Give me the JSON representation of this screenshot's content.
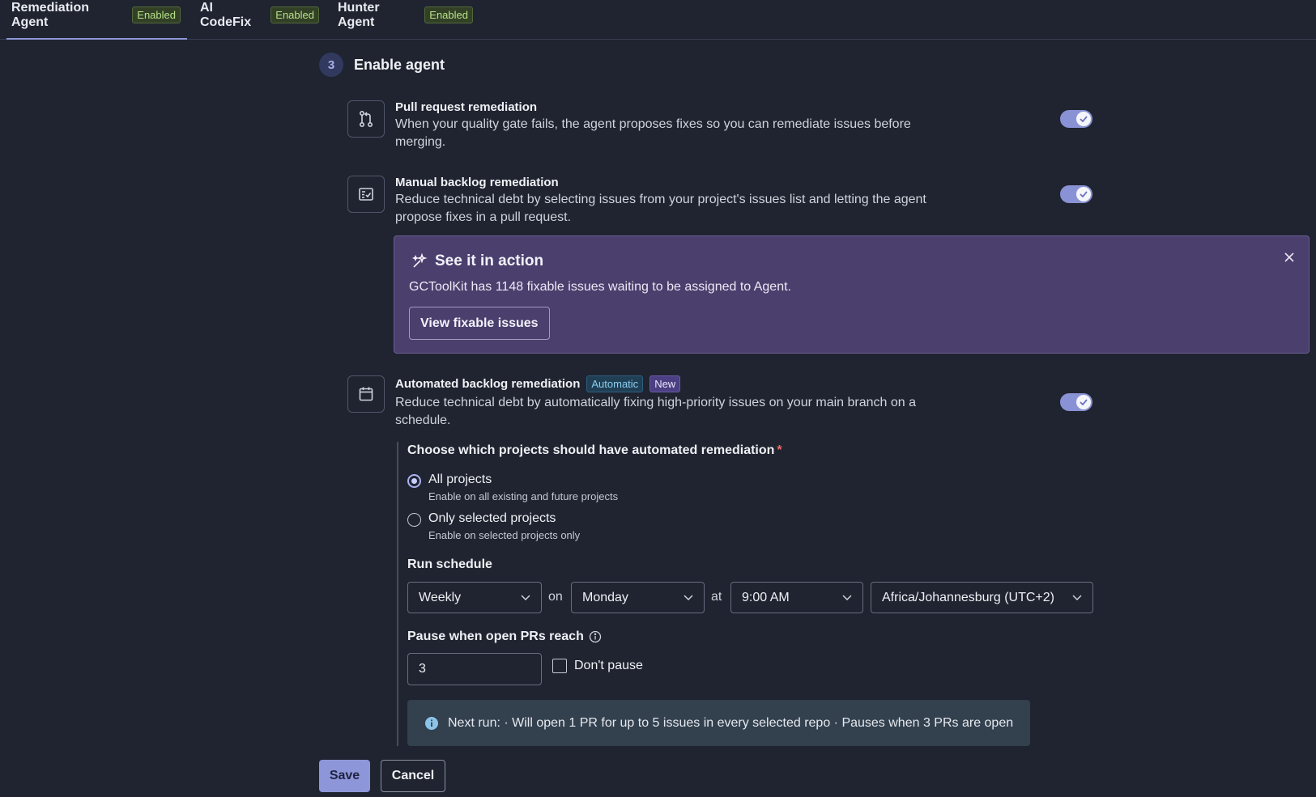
{
  "tabs": [
    {
      "label": "Remediation Agent",
      "badge": "Enabled",
      "active": true
    },
    {
      "label": "AI CodeFix",
      "badge": "Enabled",
      "active": false
    },
    {
      "label": "Hunter Agent",
      "badge": "Enabled",
      "active": false
    }
  ],
  "step": {
    "number": "3",
    "title": "Enable agent"
  },
  "features": {
    "pr": {
      "icon": "pull-request-icon",
      "title": "Pull request remediation",
      "description": "When your quality gate fails, the agent proposes fixes so you can remediate issues before merging.",
      "enabled": true
    },
    "manual": {
      "icon": "checklist-icon",
      "title": "Manual backlog remediation",
      "description": "Reduce technical debt by selecting issues from your project's issues list and letting the agent propose fixes in a pull request.",
      "enabled": true
    },
    "automated": {
      "icon": "calendar-icon",
      "title": "Automated backlog remediation",
      "chip_automatic": "Automatic",
      "chip_new": "New",
      "description": "Reduce technical debt by automatically fixing high-priority issues on your main branch on a schedule.",
      "enabled": true
    }
  },
  "promo": {
    "icon": "sparkle-icon",
    "title": "See it in action",
    "text": "GCToolKit has 1148 fixable issues waiting to be assigned to Agent.",
    "button": "View fixable issues"
  },
  "projects": {
    "label": "Choose which projects should have automated remediation",
    "required_mark": "*",
    "options": [
      {
        "label": "All projects",
        "sub": "Enable on all existing and future projects",
        "checked": true
      },
      {
        "label": "Only selected projects",
        "sub": "Enable on selected projects only",
        "checked": false
      }
    ]
  },
  "schedule": {
    "label": "Run schedule",
    "frequency": "Weekly",
    "on_text": "on",
    "day": "Monday",
    "at_text": "at",
    "time": "9:00 AM",
    "timezone": "Africa/Johannesburg (UTC+2)"
  },
  "pause": {
    "label": "Pause when open PRs reach",
    "value": "3",
    "dont_pause_label": "Don't pause",
    "dont_pause_checked": false
  },
  "info": {
    "text": "Next run: · Will open 1 PR for up to 5 issues in every selected repo · Pauses when 3 PRs are open"
  },
  "actions": {
    "save": "Save",
    "cancel": "Cancel"
  },
  "colors": {
    "accent": "#8e96da",
    "promo_bg": "#4b3f6d",
    "background": "#1f2430"
  }
}
